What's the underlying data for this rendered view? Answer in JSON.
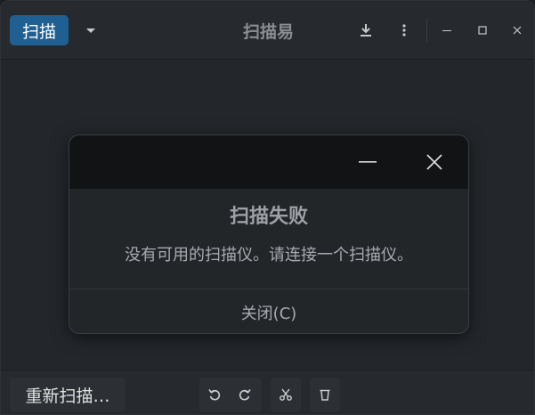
{
  "header": {
    "scan_button": "扫描",
    "title": "扫描易",
    "icons": {
      "dropdown": "chevron-down-icon",
      "save": "download-icon",
      "menu": "more-vertical-icon",
      "minimize": "minimize-icon",
      "maximize": "maximize-icon",
      "close": "close-icon"
    }
  },
  "dialog": {
    "heading": "扫描失败",
    "message": "没有可用的扫描仪。请连接一个扫描仪。",
    "close_button": "关闭(C)"
  },
  "toolbar": {
    "rescan_button": "重新扫描…",
    "icons": [
      "rotate-left-icon",
      "rotate-right-icon",
      "crop-icon",
      "delete-icon"
    ]
  },
  "colors": {
    "accent": "#1f5f92",
    "window_bg": "#23272b",
    "dialog_titlebar": "#121314"
  }
}
